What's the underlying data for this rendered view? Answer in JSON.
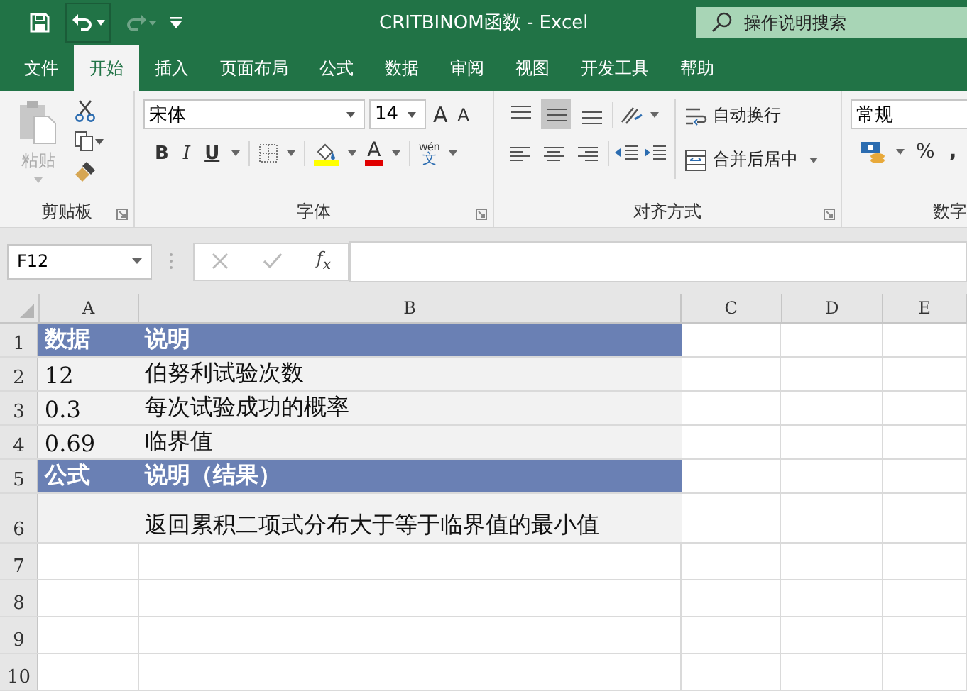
{
  "window": {
    "title": "CRITBINOM函数  -  Excel",
    "search_placeholder": "操作说明搜索",
    "redo_disabled": true
  },
  "tabs": [
    {
      "label": "文件",
      "selected": false
    },
    {
      "label": "开始",
      "selected": true
    },
    {
      "label": "插入",
      "selected": false
    },
    {
      "label": "页面布局",
      "selected": false
    },
    {
      "label": "公式",
      "selected": false
    },
    {
      "label": "数据",
      "selected": false
    },
    {
      "label": "审阅",
      "selected": false
    },
    {
      "label": "视图",
      "selected": false
    },
    {
      "label": "开发工具",
      "selected": false
    },
    {
      "label": "帮助",
      "selected": false
    }
  ],
  "clipboard": {
    "paste_label": "粘贴",
    "paste_disabled": true,
    "group_label": "剪贴板"
  },
  "font": {
    "font_name": "宋体",
    "font_size": "14",
    "grow": "A",
    "shrink": "A",
    "bold": "B",
    "italic": "I",
    "underline": "U",
    "font_color": "A",
    "phonetic_top": "wén",
    "phonetic_bottom": "文",
    "group_label": "字体"
  },
  "alignment": {
    "vertical_align": [
      {
        "selected": false
      },
      {
        "selected": true
      },
      {
        "selected": false
      }
    ],
    "wrap_text": "自动换行",
    "merge_center": "合并后居中",
    "group_label": "对齐方式"
  },
  "number": {
    "format": "常规",
    "percent": "%",
    "comma": ",",
    "group_label": "数字"
  },
  "formula_bar": {
    "name_box": "F12",
    "fx": "f$_{x}$"
  },
  "sheet": {
    "columns": [
      "A",
      "B",
      "C",
      "D",
      "E"
    ],
    "rows": [
      {
        "number": "1",
        "kind": "header",
        "cells": [
          "数据",
          "说明"
        ]
      },
      {
        "number": "2",
        "kind": "data",
        "cells": [
          "12",
          "伯努利试验次数"
        ]
      },
      {
        "number": "3",
        "kind": "data",
        "cells": [
          "0.3",
          "每次试验成功的概率"
        ]
      },
      {
        "number": "4",
        "kind": "data",
        "cells": [
          "0.69",
          "临界值"
        ]
      },
      {
        "number": "5",
        "kind": "header",
        "cells": [
          "公式",
          "说明（结果）"
        ]
      },
      {
        "number": "6",
        "kind": "tall",
        "cells": [
          "",
          "返回累积二项式分布大于等于临界值的最小值"
        ]
      },
      {
        "number": "7",
        "kind": "empty",
        "cells": []
      },
      {
        "number": "8",
        "kind": "empty",
        "cells": []
      },
      {
        "number": "9",
        "kind": "empty",
        "cells": []
      },
      {
        "number": "10",
        "kind": "empty",
        "cells": []
      }
    ]
  }
}
